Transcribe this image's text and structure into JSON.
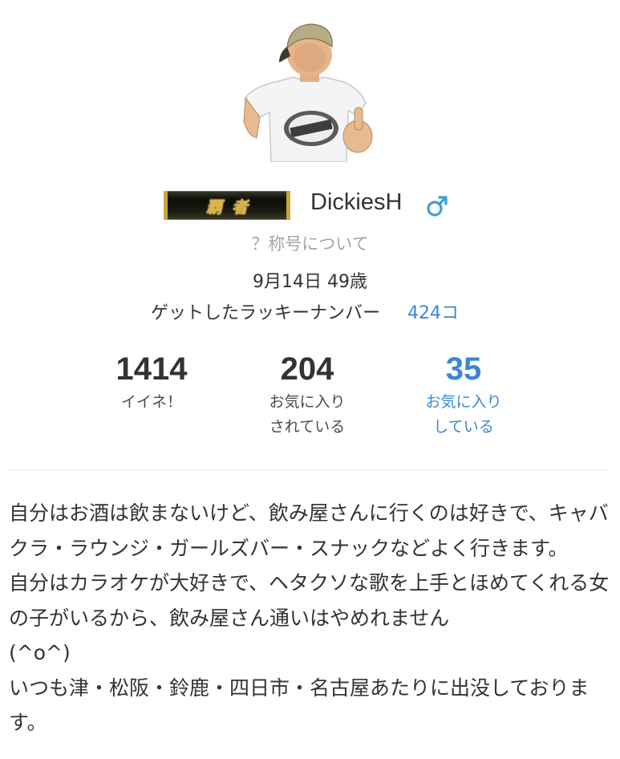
{
  "profile": {
    "avatar_icon": "user-photo-avatar",
    "title_badge": "覇者",
    "username": "DickiesH",
    "gender_icon": "male-icon",
    "title_help_link": "？称号について",
    "birthday_age": "9月14日 49歳",
    "lucky_number_label": "ゲットしたラッキーナンバー",
    "lucky_number_value": "424コ"
  },
  "stats": {
    "likes": {
      "value": "1414",
      "label": "イイネ！"
    },
    "favorited": {
      "value": "204",
      "label": "お気に入り\nされている"
    },
    "favoriting": {
      "value": "35",
      "label": "お気に入り\nしている"
    }
  },
  "bio": {
    "paragraphs": [
      "自分はお酒は飲まないけど、飲み屋さんに行くのは好きで、キャバクラ・ラウンジ・ガールズバー・スナックなどよく行きます。",
      "自分はカラオケが大好きで、ヘタクソな歌を上手とほめてくれる女の子がいるから、飲み屋さん通いはやめれません\n(^o^)",
      "いつも津・松阪・鈴鹿・四日市・名古屋あたりに出没しております。"
    ]
  },
  "colors": {
    "link_blue": "#3a87d6",
    "muted_gray": "#a6a6a6",
    "text": "#333333",
    "badge_gold": "#d8b24a"
  }
}
